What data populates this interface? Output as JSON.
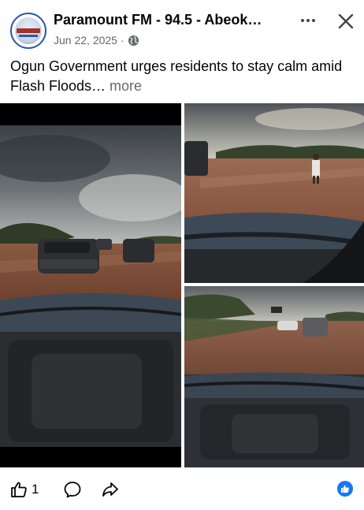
{
  "post": {
    "page_name": "Paramount FM - 94.5 - Abeok…",
    "date": "Jun 22, 2025",
    "separator": "·",
    "audience_icon": "globe-icon",
    "caption_text": "Ogun Government urges residents to stay calm amid Flash Floods… ",
    "caption_more": "more"
  },
  "header_actions": {
    "more_icon": "ellipsis-icon",
    "close_icon": "close-icon"
  },
  "photos": [
    {
      "name": "flood-photo-road-cars",
      "icon": "photo"
    },
    {
      "name": "flood-photo-person-wading",
      "icon": "photo"
    },
    {
      "name": "flood-photo-highway-traffic",
      "icon": "photo"
    }
  ],
  "actions": {
    "like_icon": "thumbs-up-icon",
    "like_count": "1",
    "comment_icon": "comment-icon",
    "share_icon": "share-icon",
    "reaction_icon": "like-reaction-icon"
  },
  "colors": {
    "brand_blue": "#1877f2",
    "secondary_text": "#65676b",
    "primary_text": "#050505"
  }
}
